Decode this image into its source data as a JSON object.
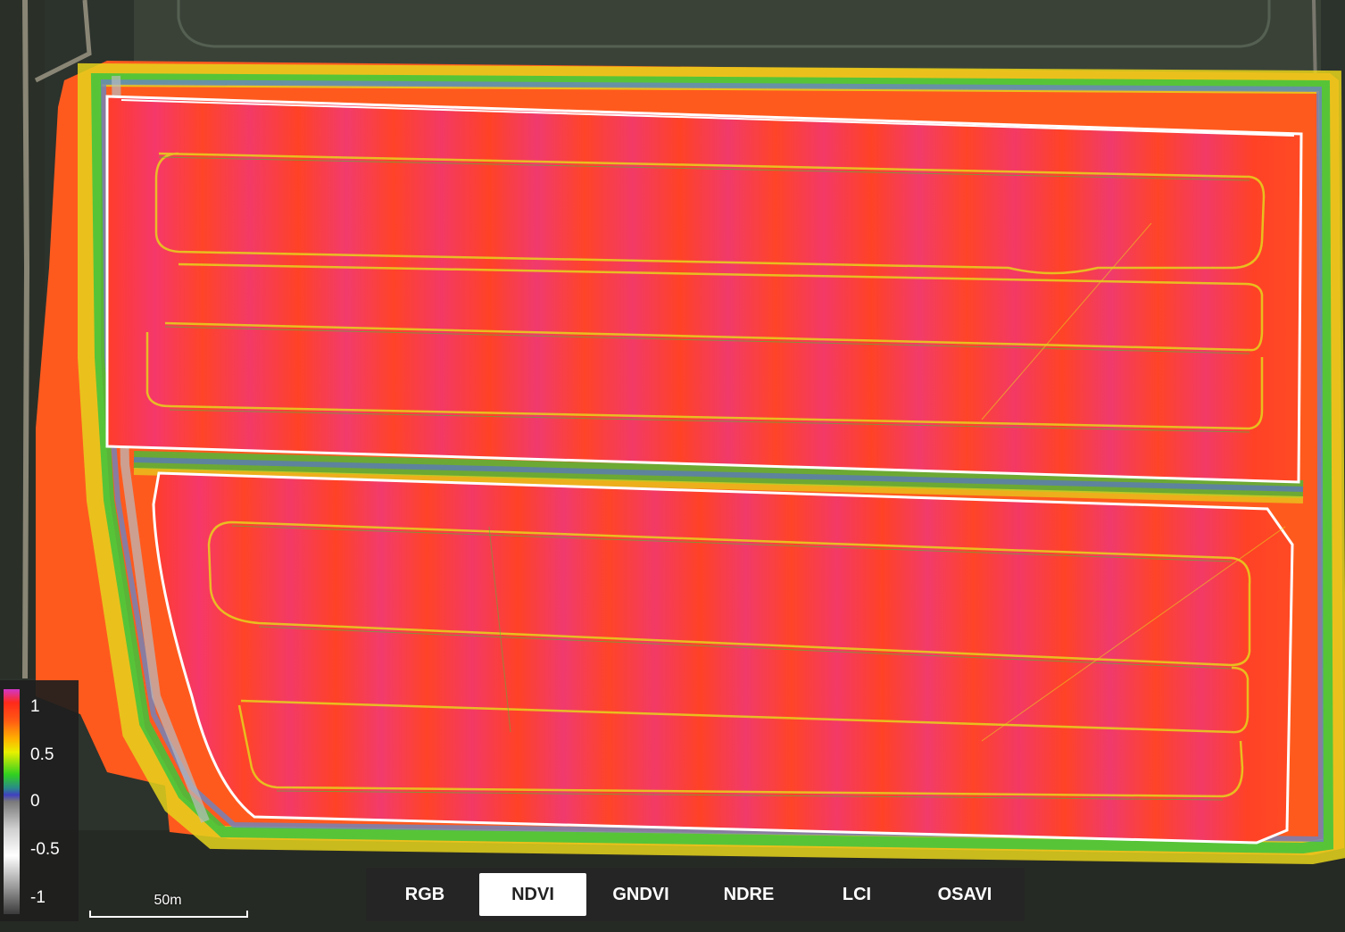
{
  "map": {
    "active_index": "NDVI",
    "colors": {
      "field_base": "#ff4a24",
      "field_pink": "#f2406e",
      "margin_yellow": "#e9d820",
      "margin_green": "#3cc43c",
      "margin_blue": "#5a78b8",
      "boundary": "#ffffff",
      "background_dark": "#2b302b"
    }
  },
  "legend": {
    "labels": [
      "1",
      "0.5",
      "0",
      "-0.5",
      "-1"
    ]
  },
  "scale_bar": {
    "label": "50m"
  },
  "tabs": [
    {
      "label": "RGB",
      "active": false
    },
    {
      "label": "NDVI",
      "active": true
    },
    {
      "label": "GNDVI",
      "active": false
    },
    {
      "label": "NDRE",
      "active": false
    },
    {
      "label": "LCI",
      "active": false
    },
    {
      "label": "OSAVI",
      "active": false
    }
  ]
}
